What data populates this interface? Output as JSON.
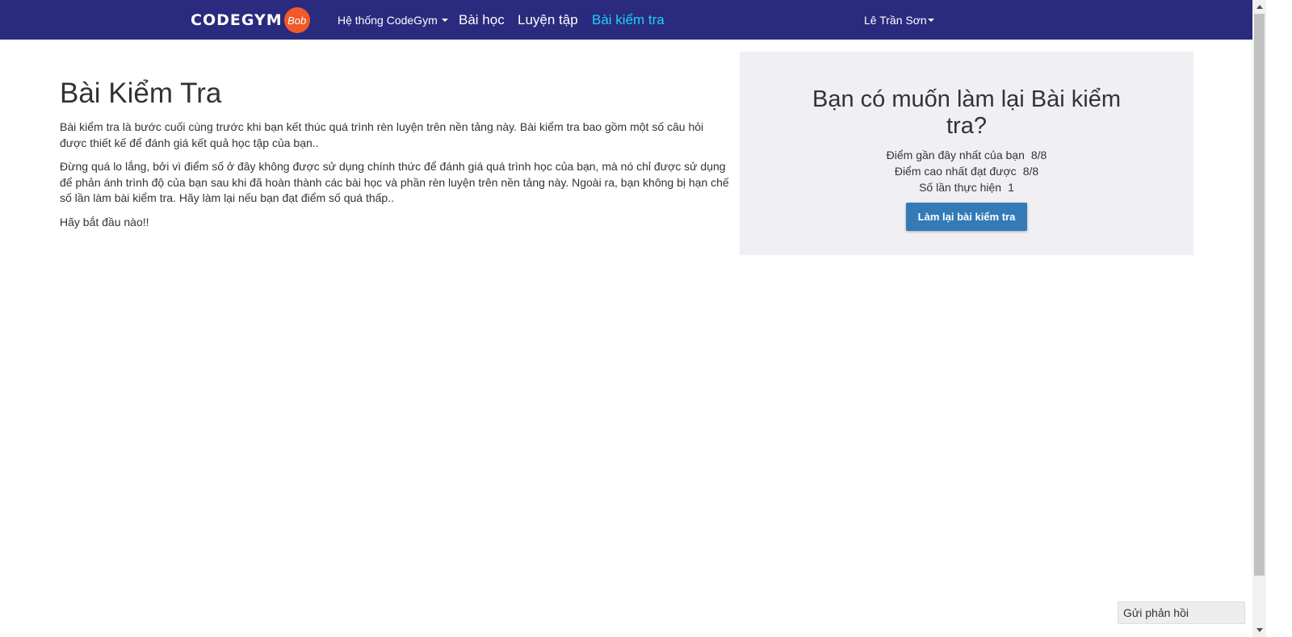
{
  "nav": {
    "logo_text": "CODEGYM",
    "logo_badge": "Bob",
    "system_label": "Hệ thống CodeGym",
    "lessons_label": "Bài học",
    "practice_label": "Luyện tập",
    "test_label": "Bài kiểm tra",
    "user_label": "Lê Trần Sơn",
    "colors": {
      "navbar_bg": "#2a2a7e",
      "active_link": "#19d4f5",
      "logo_badge": "#f05a28"
    }
  },
  "intro": {
    "title": "Bài Kiểm Tra",
    "paragraphs": [
      "Bài kiểm tra là bước cuối cùng trước khi bạn kết thúc quá trình rèn luyện trên nền tảng này. Bài kiểm tra bao gồm một số câu hỏi được thiết kế để đánh giá kết quả học tập của bạn..",
      "Đừng quá lo lắng, bởi vì điểm số ở đây không được sử dụng chính thức để đánh giá quá trình học của bạn, mà nó chỉ được sử dụng để phản ánh trình độ của bạn sau khi đã hoàn thành các bài học và phần rèn luyện trên nền tảng này. Ngoài ra, bạn không bị hạn chế số lần làm bài kiểm tra. Hãy làm lại nếu bạn đạt điểm số quá thấp..",
      "Hãy bắt đầu nào!!"
    ]
  },
  "retry": {
    "title": "Bạn có muốn làm lại Bài kiểm tra?",
    "stats": [
      {
        "label": "Điểm gần đây nhất của bạn",
        "value": "8/8"
      },
      {
        "label": "Điểm cao nhất đạt được",
        "value": "8/8"
      },
      {
        "label": "Số lần thực hiện",
        "value": "1"
      }
    ],
    "button_label": "Làm lại bài kiểm tra",
    "colors": {
      "panel_bg": "#f0f0f4",
      "button_bg": "#337ab7"
    }
  },
  "feedback_label": "Gửi phản hồi"
}
